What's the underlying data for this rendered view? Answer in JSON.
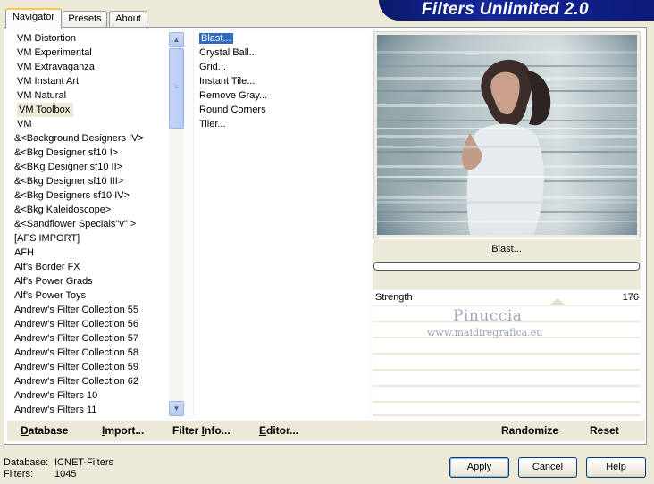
{
  "tabs": [
    "Navigator",
    "Presets",
    "About"
  ],
  "banner_title": "Filters Unlimited 2.0",
  "categories": [
    "VM Distortion",
    "VM Experimental",
    "VM Extravaganza",
    "VM Instant Art",
    "VM Natural",
    "VM Toolbox",
    "VM",
    "&<Background Designers IV>",
    "&<Bkg Designer sf10 I>",
    "&<BKg Designer sf10 II>",
    "&<Bkg Designer sf10 III>",
    "&<Bkg Designers sf10 IV>",
    "&<Bkg Kaleidoscope>",
    "&<Sandflower Specials\"v\" >",
    "[AFS IMPORT]",
    "AFH",
    "Alf's Border FX",
    "Alf's Power Grads",
    "Alf's Power Toys",
    "Andrew's Filter Collection 55",
    "Andrew's Filter Collection 56",
    "Andrew's Filter Collection 57",
    "Andrew's Filter Collection 58",
    "Andrew's Filter Collection 59",
    "Andrew's Filter Collection 62",
    "Andrew's Filters 10",
    "Andrew's Filters 11"
  ],
  "selected_category": "VM Toolbox",
  "filters": [
    "Blast...",
    "Crystal Ball...",
    "Grid...",
    "Instant Tile...",
    "Remove Gray...",
    "Round Corners",
    "Tiler..."
  ],
  "selected_filter": "Blast...",
  "current_filter_name": "Blast...",
  "strength": {
    "label": "Strength",
    "value": "176",
    "level": 0.69
  },
  "watermark": {
    "line1": "Pinuccia",
    "line2": "www.maidiregrafica.eu"
  },
  "bottom_links": {
    "database": "Database",
    "import": "Import...",
    "filter_info": "Filter Info...",
    "editor": "Editor...",
    "randomize": "Randomize",
    "reset": "Reset"
  },
  "status": {
    "database_label": "Database:",
    "database_value": "ICNET-Filters",
    "filters_label": "Filters:",
    "filters_value": "1045"
  },
  "buttons": {
    "apply": "Apply",
    "cancel": "Cancel",
    "help": "Help"
  }
}
